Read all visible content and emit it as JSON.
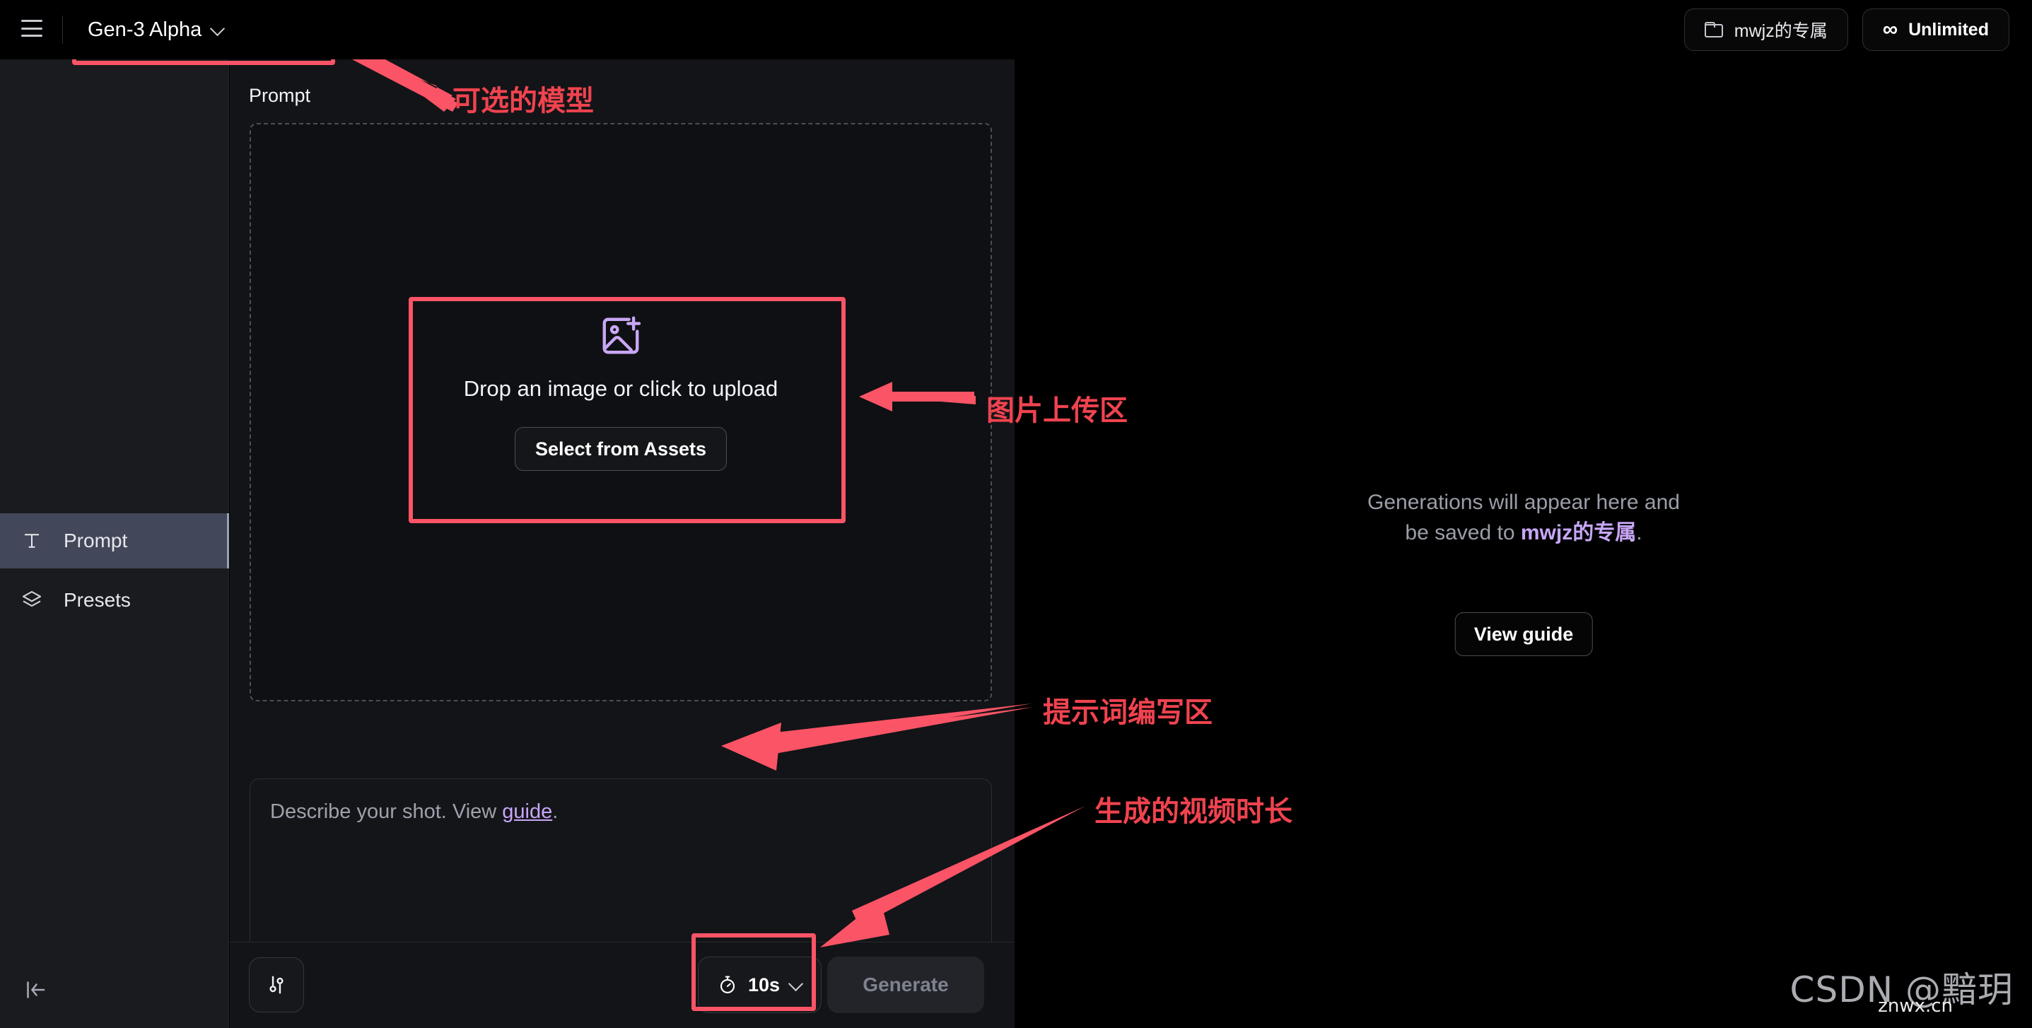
{
  "topbar": {
    "menu_icon": "hamburger-icon",
    "model_selector": {
      "label": "Gen-3 Alpha",
      "chevron": "chevron-down-icon"
    },
    "workspace": {
      "label": "mwjz的专属",
      "icon": "folder-icon"
    },
    "plan": {
      "label": "Unlimited",
      "icon": "infinity-icon"
    }
  },
  "sidebar": {
    "items": [
      {
        "label": "Prompt",
        "icon": "text-t-icon",
        "active": true
      },
      {
        "label": "Presets",
        "icon": "layers-icon",
        "active": false
      }
    ],
    "collapse_icon": "collapse-panel-left-icon"
  },
  "panel": {
    "section_label": "Prompt",
    "upload": {
      "icon": "image-plus-icon",
      "text": "Drop an image or click to upload",
      "button_label": "Select from Assets"
    },
    "prompt_input": {
      "placeholder_prefix": "Describe your shot. View ",
      "placeholder_link": "guide",
      "placeholder_suffix": ".",
      "value": ""
    },
    "toolbar": {
      "settings_icon": "sliders-icon",
      "duration": {
        "value": "10s",
        "icon": "stopwatch-icon",
        "chevron": "chevron-down-icon"
      },
      "generate_label": "Generate",
      "generate_disabled": true
    }
  },
  "preview": {
    "message_line1": "Generations will appear here and",
    "message_line2_prefix": "be saved to ",
    "message_line2_highlight": "mwjz的专属",
    "message_line2_suffix": ".",
    "button_label": "View guide"
  },
  "annotations": {
    "color": "#f0434f",
    "model": "可选的模型",
    "upload": "图片上传区",
    "prompt": "提示词编写区",
    "duration": "生成的视频时长"
  },
  "watermark": {
    "text": "CSDN @黯玥",
    "sub": "znwx.cn"
  }
}
